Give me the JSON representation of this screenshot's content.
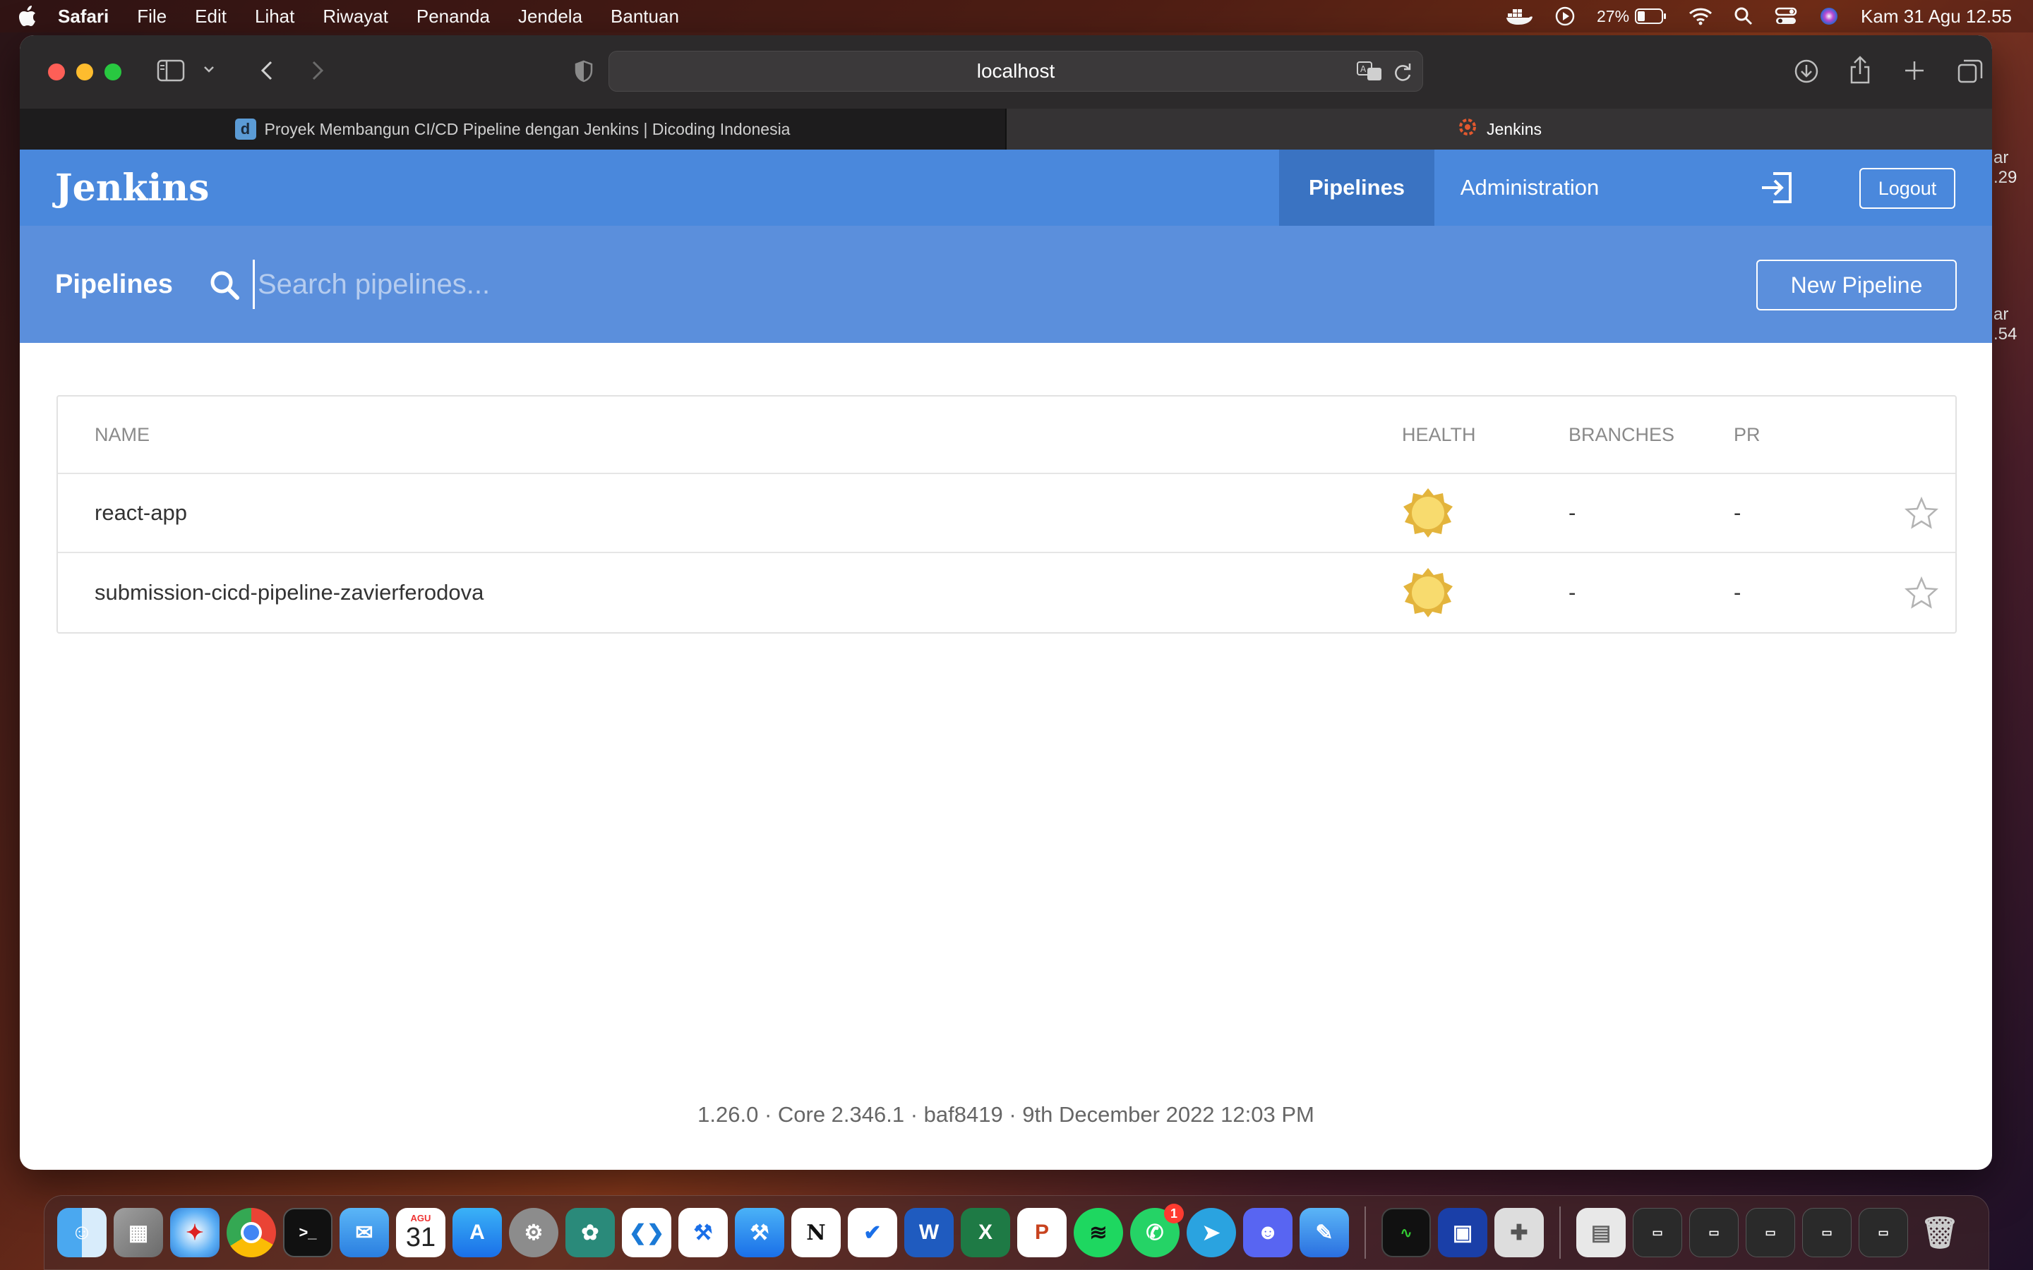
{
  "menubar": {
    "app_name": "Safari",
    "menus": [
      "File",
      "Edit",
      "Lihat",
      "Riwayat",
      "Penanda",
      "Jendela",
      "Bantuan"
    ],
    "battery": "27%",
    "datetime": "Kam 31 Agu  12.55"
  },
  "browser": {
    "url": "localhost",
    "tabs": [
      {
        "title": "Proyek Membangun CI/CD Pipeline dengan Jenkins | Dicoding Indonesia",
        "active": false
      },
      {
        "title": "Jenkins",
        "active": true
      }
    ]
  },
  "jenkins": {
    "logo": "Jenkins",
    "nav": {
      "pipelines": "Pipelines",
      "administration": "Administration"
    },
    "logout": "Logout",
    "subheader": {
      "title": "Pipelines",
      "search_placeholder": "Search pipelines...",
      "new_pipeline": "New Pipeline"
    },
    "table": {
      "headers": {
        "name": "NAME",
        "health": "HEALTH",
        "branches": "BRANCHES",
        "pr": "PR"
      },
      "rows": [
        {
          "name": "react-app",
          "health": "sunny",
          "branches": "-",
          "pr": "-"
        },
        {
          "name": "submission-cicd-pipeline-zavierferodova",
          "health": "sunny",
          "branches": "-",
          "pr": "-"
        }
      ]
    },
    "footer": "1.26.0 · Core 2.346.1 · baf8419 · 9th December 2022 12:03 PM"
  },
  "dock": {
    "calendar_month": "AGU",
    "calendar_day": "31",
    "whatsapp_badge": "1"
  },
  "colors": {
    "jenkins_header": "#4a88dc",
    "jenkins_subheader": "#5b8fdc",
    "health_sunny": "#f7d360"
  }
}
